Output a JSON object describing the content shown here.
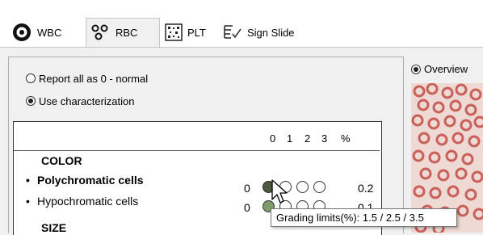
{
  "tabs": [
    {
      "label": "WBC",
      "icon": "target-icon",
      "active": false
    },
    {
      "label": "RBC",
      "icon": "rbc-cells-icon",
      "active": true
    },
    {
      "label": "PLT",
      "icon": "platelet-grid-icon",
      "active": false
    },
    {
      "label": "Sign Slide",
      "icon": "sign-check-icon",
      "active": false
    }
  ],
  "report_options": {
    "option1": {
      "label": "Report all as 0 - normal",
      "selected": false
    },
    "option2": {
      "label": "Use characterization",
      "selected": true
    }
  },
  "grading": {
    "headers": [
      "0",
      "1",
      "2",
      "3",
      "%"
    ],
    "section_color": "COLOR",
    "section_size": "SIZE",
    "rows": [
      {
        "label": "Polychromatic cells",
        "bold": true,
        "zero": "0",
        "percent": "0.2",
        "selected_grade": 0
      },
      {
        "label": "Hypochromatic cells",
        "bold": false,
        "zero": "0",
        "percent": "0.1",
        "selected_grade": 0
      }
    ]
  },
  "overview": {
    "label": "Overview",
    "selected": true
  },
  "tooltip": {
    "text": "Grading limits(%): 1.5 / 2.5 / 3.5"
  },
  "colors": {
    "filled_dark": "#4b5a3e",
    "filled_green": "#7e9b6a",
    "cell": "#c9605a",
    "overview_bg": "#efd9d4"
  }
}
